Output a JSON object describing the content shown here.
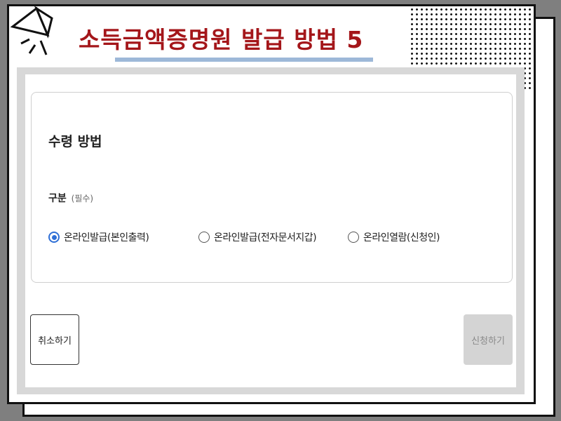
{
  "slide": {
    "title": "소득금액증명원 발급 방법 5",
    "colors": {
      "title": "#a4161a",
      "underline": "#9db8d8"
    }
  },
  "form": {
    "section_title": "수령 방법",
    "field_label": "구분",
    "field_required": "(필수)",
    "options": [
      {
        "label": "온라인발급(본인출력)",
        "selected": true
      },
      {
        "label": "온라인발급(전자문서지갑)",
        "selected": false
      },
      {
        "label": "온라인열람(신청인)",
        "selected": false
      }
    ],
    "accent_color": "#2f6fd6"
  },
  "buttons": {
    "cancel": "취소하기",
    "apply": "신청하기"
  }
}
